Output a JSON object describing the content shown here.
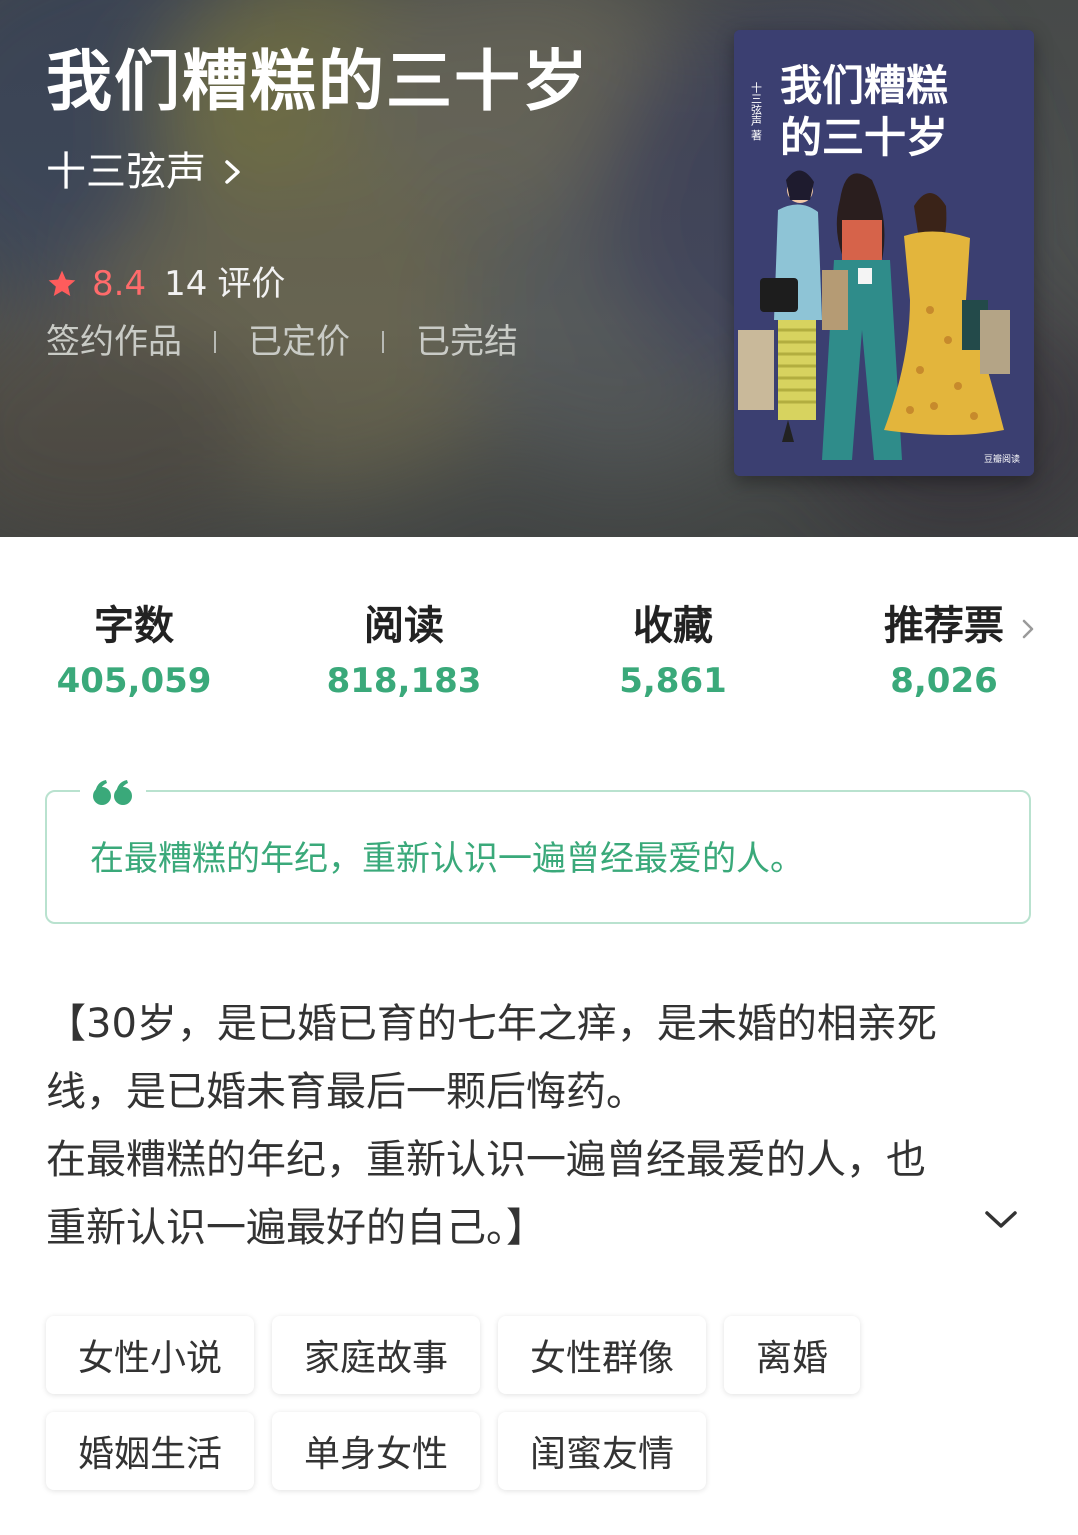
{
  "book": {
    "title": "我们糟糕的三十岁",
    "author": "十三弦声",
    "rating": "8.4",
    "rating_count": "14",
    "rating_unit": "评价",
    "status": [
      "签约作品",
      "已定价",
      "已完结"
    ],
    "cover": {
      "title_line1": "我们糟糕",
      "title_line2": "的三十岁",
      "author_vertical": "十三弦声 著",
      "publisher": "豆瓣阅读"
    }
  },
  "stats": [
    {
      "label": "字数",
      "value": "405,059"
    },
    {
      "label": "阅读",
      "value": "818,183"
    },
    {
      "label": "收藏",
      "value": "5,861"
    },
    {
      "label": "推荐票",
      "value": "8,026"
    }
  ],
  "quote": {
    "text": "在最糟糕的年纪，重新认识一遍曾经最爱的人。"
  },
  "description": {
    "line1": "【30岁，是已婚已育的七年之痒，是未婚的相亲死",
    "line2": "线，是已婚未育最后一颗后悔药。",
    "line3": "在最糟糕的年纪，重新认识一遍曾经最爱的人，也",
    "line4": "重新认识一遍最好的自己。】"
  },
  "tags": {
    "row1": [
      "女性小说",
      "家庭故事",
      "女性群像",
      "离婚"
    ],
    "row2": [
      "婚姻生活",
      "单身女性",
      "闺蜜友情"
    ]
  },
  "icons": {
    "author_link": "chevron-right-icon",
    "rating": "star-icon",
    "stat_more": "chevron-right-icon",
    "quote": "quote-icon",
    "expand": "chevron-down-icon"
  },
  "colors": {
    "accent_green": "#3aa97a",
    "rating_red": "#ff6b6b",
    "quote_border": "#b9e2cf",
    "cover_bg": "#3b3f71"
  }
}
